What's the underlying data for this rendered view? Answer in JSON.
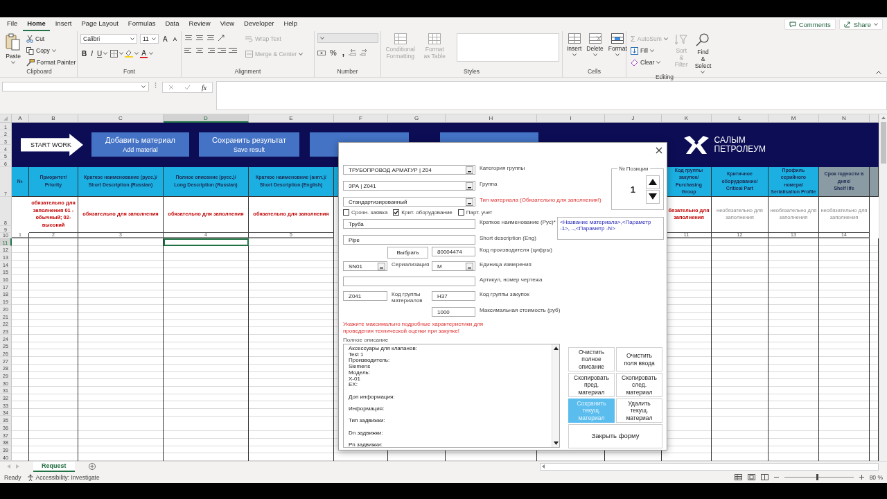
{
  "ribbon": {
    "tabs": [
      {
        "label": "File",
        "selected": false
      },
      {
        "label": "Home",
        "selected": true
      },
      {
        "label": "Insert",
        "selected": false
      },
      {
        "label": "Page Layout",
        "selected": false
      },
      {
        "label": "Formulas",
        "selected": false
      },
      {
        "label": "Data",
        "selected": false
      },
      {
        "label": "Review",
        "selected": false
      },
      {
        "label": "View",
        "selected": false
      },
      {
        "label": "Developer",
        "selected": false
      },
      {
        "label": "Help",
        "selected": false
      }
    ],
    "comments": "Comments",
    "share": "Share",
    "clipboard": {
      "paste": "Paste",
      "cut": "Cut",
      "copy": "Copy",
      "format_painter": "Format Painter",
      "label": "Clipboard"
    },
    "font": {
      "name": "Calibri",
      "size": "11",
      "grow": "A",
      "shrink": "A",
      "bold": "B",
      "italic": "I",
      "underline": "U",
      "font_color": "A",
      "label": "Font"
    },
    "alignment": {
      "wrap_text": {
        "label": "Wrap Text",
        "disabled": true
      },
      "merge": {
        "label": "Merge & Center",
        "disabled": true
      },
      "label": "Alignment"
    },
    "number": {
      "percent": "%",
      "comma": ",",
      "label": "Number"
    },
    "styles": {
      "conditional": {
        "label": "Conditional Formatting",
        "disabled": true
      },
      "format_table": {
        "label": "Format as Table",
        "disabled": true
      },
      "label": "Styles"
    },
    "cells": {
      "insert": "Insert",
      "delete": "Delete",
      "format": "Format",
      "label": "Cells"
    },
    "editing": {
      "autosum_symbol": "Σ",
      "autosum": {
        "label": "AutoSum",
        "disabled": true
      },
      "fill": {
        "label": "Fill",
        "disabled": false
      },
      "clear": {
        "label": "Clear",
        "disabled": false
      },
      "sort": {
        "label": "Sort & Filter",
        "disabled": true
      },
      "find": {
        "label": "Find & Select",
        "disabled": false
      },
      "label": "Editing"
    }
  },
  "formula_bar": {
    "function_label": "fx"
  },
  "sheet": {
    "columns": [
      {
        "letter": "A",
        "selected": false,
        "color": "#1cb0e2",
        "header": "№",
        "number": "1"
      },
      {
        "letter": "B",
        "selected": false,
        "color": "#1cb0e2",
        "header": "Приоритет/\nPriority",
        "note": "обязательно для заполнения 01 - обычный; 02-высокий",
        "required": true,
        "number": "2"
      },
      {
        "letter": "C",
        "selected": false,
        "color": "#1cb0e2",
        "header": "Краткое наименование (русс.)/\nShort Description (Russian)",
        "note": "обязательно для заполнения",
        "required": true,
        "number": "3"
      },
      {
        "letter": "D",
        "selected": true,
        "color": "#1cb0e2",
        "header": "Полное описание (русс.)/\nLong Description (Russian)",
        "note": "обязательно для заполнения",
        "required": true,
        "number": "4"
      },
      {
        "letter": "E",
        "selected": false,
        "color": "#1cb0e2",
        "header": "Краткое наименовние (англ.)/\nShort Description (English)",
        "note": "обязательно для заполнения",
        "required": true,
        "number": "5"
      },
      {
        "letter": "F",
        "selected": false,
        "color": "#1cb0e2"
      },
      {
        "letter": "G",
        "selected": false
      },
      {
        "letter": "H",
        "selected": false
      },
      {
        "letter": "I",
        "selected": false
      },
      {
        "letter": "J",
        "selected": false
      },
      {
        "letter": "K",
        "selected": false,
        "color": "#1cb0e2",
        "header": "Код группы\nзакупок/\nPurchasing Group",
        "note": "бязательно для заполнения",
        "required": true,
        "number": "11"
      },
      {
        "letter": "L",
        "selected": false,
        "color": "#1cb0e2",
        "header": "Критичное\nоборудование/\nCritical Part",
        "note": "необязательно для заполнения",
        "required": false,
        "number": "12"
      },
      {
        "letter": "M",
        "selected": false,
        "color": "#1cb0e2",
        "header": "Профиль серийного\nномера/\nSerialisation Profile",
        "note": "необязательно для заполнения",
        "required": false,
        "number": "13"
      },
      {
        "letter": "N",
        "selected": false,
        "color": "#8a9ba3",
        "header": "Срок годности в\nднях/\nShelf life",
        "note": "необязательно для заполнения",
        "required": false,
        "number": "14"
      },
      {
        "color": "#8a9ba3"
      }
    ],
    "rows": [
      {
        "label": "1",
        "selected": false
      },
      {
        "label": "2",
        "selected": false
      },
      {
        "label": "3",
        "selected": false
      },
      {
        "label": "4",
        "selected": false
      },
      {
        "label": "5",
        "selected": false
      },
      {
        "label": "6",
        "selected": false
      },
      {
        "label": "7",
        "selected": false
      },
      {
        "label": "8",
        "selected": false
      },
      {
        "label": "9",
        "selected": false
      },
      {
        "label": "10",
        "selected": false
      },
      {
        "label": "11",
        "selected": true
      },
      {
        "label": "12",
        "selected": false
      },
      {
        "label": "13",
        "selected": false
      },
      {
        "label": "14",
        "selected": false
      },
      {
        "label": "15",
        "selected": false
      },
      {
        "label": "16",
        "selected": false
      },
      {
        "label": "17",
        "selected": false
      },
      {
        "label": "18",
        "selected": false
      },
      {
        "label": "19",
        "selected": false
      },
      {
        "label": "20",
        "selected": false
      },
      {
        "label": "21",
        "selected": false
      },
      {
        "label": "22",
        "selected": false
      },
      {
        "label": "23",
        "selected": false
      },
      {
        "label": "24",
        "selected": false
      },
      {
        "label": "25",
        "selected": false
      },
      {
        "label": "26",
        "selected": false
      },
      {
        "label": "27",
        "selected": false
      },
      {
        "label": "28",
        "selected": false
      },
      {
        "label": "29",
        "selected": false
      },
      {
        "label": "30",
        "selected": false
      },
      {
        "label": "31",
        "selected": false
      },
      {
        "label": "32",
        "selected": false
      },
      {
        "label": "33",
        "selected": false
      },
      {
        "label": "34",
        "selected": false
      },
      {
        "label": "35",
        "selected": false
      },
      {
        "label": "36",
        "selected": false
      },
      {
        "label": "37",
        "selected": false
      },
      {
        "label": "38",
        "selected": false
      },
      {
        "label": "39",
        "selected": false
      },
      {
        "label": "40",
        "selected": false
      }
    ],
    "banner": {
      "start_work": "START WORK",
      "buttons": [
        {
          "title": "Добавить материал",
          "subtitle": "Add material"
        },
        {
          "title": "Сохранить результат",
          "subtitle": "Save result"
        }
      ],
      "logo": [
        "САЛЫМ",
        "ПЕТРОЛЕУМ"
      ]
    }
  },
  "sheet_tabs": [
    {
      "label": "Request",
      "selected": true
    }
  ],
  "status_bar": {
    "status": "Ready",
    "accessibility": "Accessibility: Investigate",
    "zoom": "80 %",
    "zoom_slider": {
      "level": 0.46
    }
  },
  "dialog": {
    "combos": [
      {
        "value": "ТРУБОПРОВОД АРМАТУР | Z04",
        "label": "Категория группы",
        "required": false
      },
      {
        "value": "ЗРА | Z041",
        "label": "Группа",
        "required": false
      },
      {
        "value": "Стандартизированный",
        "label": "Тип материала (Обязательно для заполнения!)",
        "required": true
      }
    ],
    "checkboxes": [
      {
        "label": "Срочн. заявка",
        "checked": false
      },
      {
        "label": "Крит. оборудование",
        "checked": true
      },
      {
        "label": "Парт. учет",
        "checked": false
      }
    ],
    "position": {
      "legend": "№ Позиции",
      "value": "1"
    },
    "short_ru": {
      "value": "Труба",
      "label": "Краткое наименование (Рус)*"
    },
    "hint": "<Название материала>,<Параметр -1>, ..,<Параметр -N>",
    "short_en": {
      "value": "Pipe",
      "label": "Short description (Eng)"
    },
    "select_button": "Выбрать",
    "manufacturer_code": {
      "value": "80004474",
      "label": "Код производителя (цифры)"
    },
    "serialization": {
      "value": "SN01",
      "label": "Сериализация"
    },
    "unit": {
      "value": "M",
      "label": "Единица измерения"
    },
    "article": {
      "label": "Артикул, номер чертежа"
    },
    "material_group": {
      "value": "Z041",
      "label": "Код группы\nматериалов"
    },
    "purchasing_group": {
      "value": "H37",
      "label": "Код группы закупок"
    },
    "max_cost": {
      "value": "1000",
      "label": "Максимальная стоимость (руб)"
    },
    "warning": "Укажите максимально подробные характеристики для\nпроведения технической оценки при закупке!",
    "description": {
      "label": "Полное описание",
      "value": "Аксессуары для клапанов:\nTest 1\nПроизводитель:\nSiemens\nМодель:\nX-01\nEX:\n\nДоп информация:\n\nИнформация:\n\nТип задвижки:\n\nDn задвижки:\n\nPn задвижки:"
    },
    "actions": [
      {
        "label": "Очистить\nполное\nописание",
        "highlighted": false
      },
      {
        "label": "Очистить\nполя ввода",
        "highlighted": false
      },
      {
        "label": "Скопировать\nпред.\nматериал",
        "highlighted": false
      },
      {
        "label": "Скопировать\nслед.\nматериал",
        "highlighted": false
      },
      {
        "label": "Сохранить\nтекущ.\nматериал",
        "highlighted": true
      },
      {
        "label": "Удалить\nтекущ.\nматериал",
        "highlighted": false
      },
      {
        "label": "Закрыть форму",
        "highlighted": false
      }
    ]
  }
}
